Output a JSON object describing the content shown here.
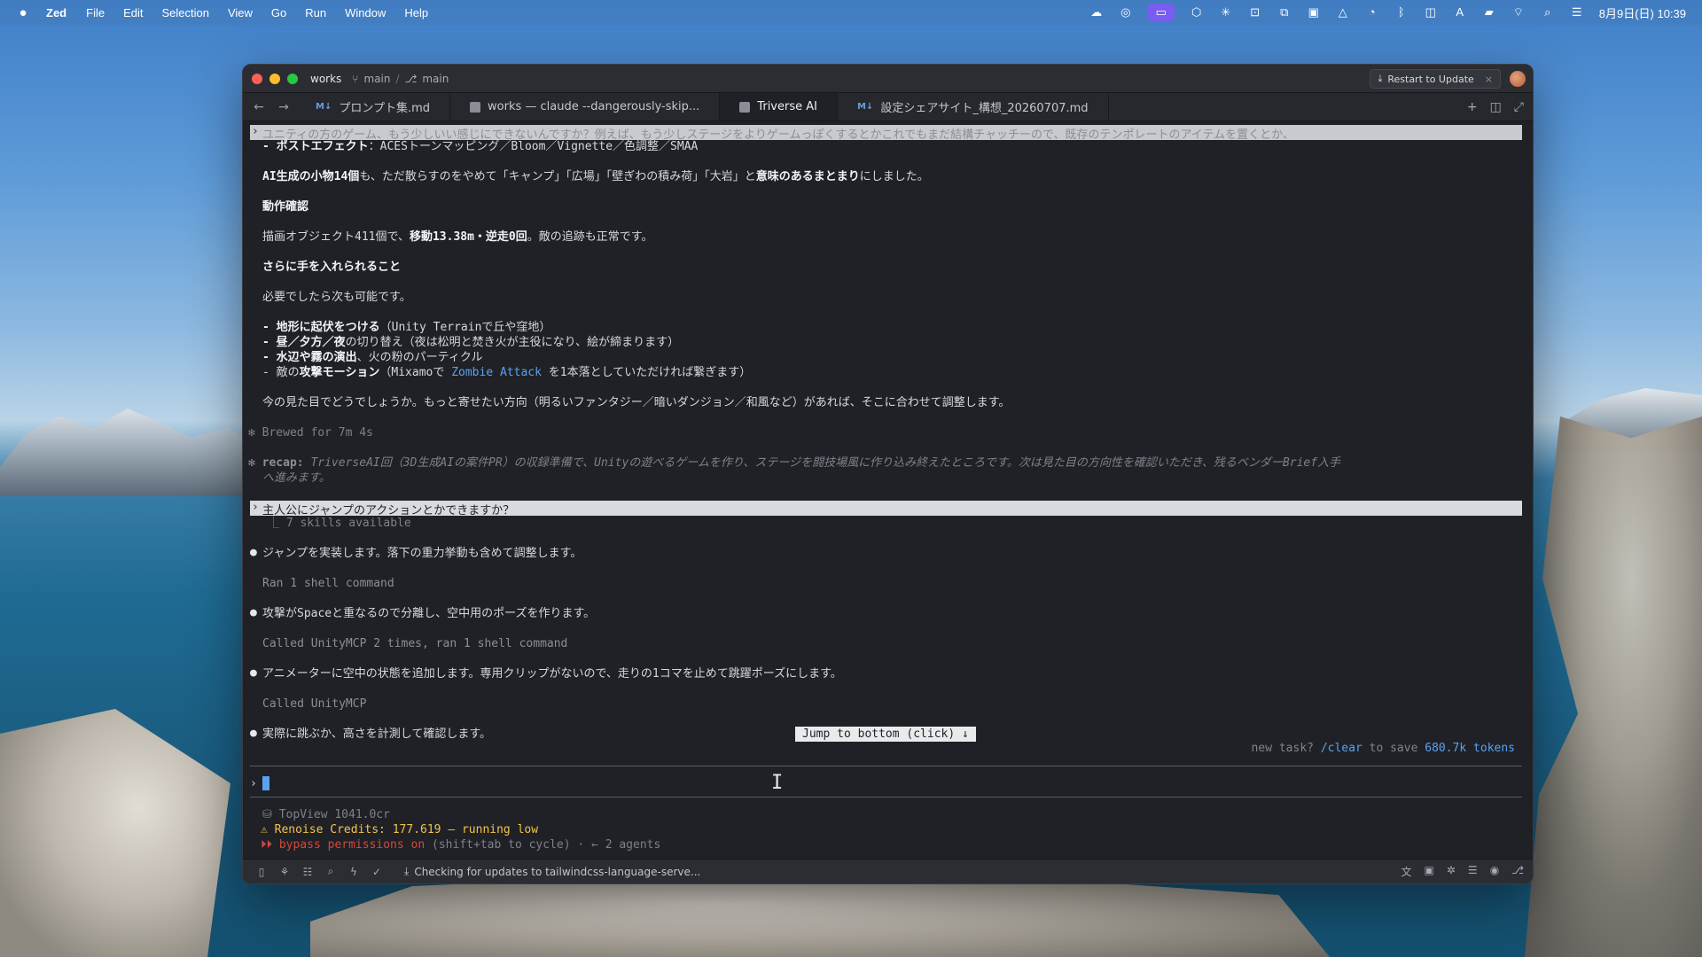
{
  "menubar": {
    "app_name": "Zed",
    "items": [
      "File",
      "Edit",
      "Selection",
      "View",
      "Go",
      "Run",
      "Window",
      "Help"
    ],
    "clock": "8月9日(日) 10:39",
    "input_indicator": "A"
  },
  "window": {
    "project": "works",
    "branch_1": "main",
    "branch_2": "main",
    "restart_label": "Restart to Update",
    "tabs": [
      {
        "label": "プロンプト集.md",
        "icon": "md-icon",
        "active": false
      },
      {
        "label": "works — claude --dangerously-skip...",
        "icon": "terminal-icon",
        "active": false
      },
      {
        "label": "Triverse AI",
        "icon": "terminal-icon",
        "active": true
      },
      {
        "label": "設定シェアサイト_構想_20260707.md",
        "icon": "md-icon",
        "active": false
      }
    ]
  },
  "terminal": {
    "top_prompt": "ユニティの方のゲーム、もう少しいい感じにできないんですか？例えば、もう少しステージをよりゲームっぽくするとかこれでもまだ結構チャッチーので、既存のテンポレートのアイテムを置くとか、",
    "post_effect_label": "- ポストエフェクト",
    "post_effect_value": "：ACESトーンマッピング／Bloom／Vignette／色調整／SMAA",
    "ai_items_bold": "AI生成の小物14個",
    "ai_items_mid": "も、ただ散らすのをやめて「キャンプ」「広場」「壁ぎわの積み荷」「大岩」と",
    "ai_items_bold2": "意味のあるまとまり",
    "ai_items_end": "にしました。",
    "check_heading": "動作確認",
    "check_pre": "描画オブジェクト411個で、",
    "check_bold": "移動13.38m・逆走0回",
    "check_end": "。敵の追跡も正常です。",
    "more_heading": "さらに手を入れられること",
    "more_intro": "必要でしたら次も可能です。",
    "opt1_bold": "- 地形に起伏をつける",
    "opt1_rest": "（Unity Terrainで丘や窪地）",
    "opt2_bold": "- 昼／夕方／夜",
    "opt2_rest": "の切り替え（夜は松明と焚き火が主役になり、絵が締まります）",
    "opt3_bold": "- 水辺や霧の演出",
    "opt3_rest": "、火の粉のパーティクル",
    "opt4_pre": "- 敵の",
    "opt4_bold": "攻撃モーション",
    "opt4_mid": "（Mixamoで ",
    "opt4_link": "Zombie Attack",
    "opt4_end": " を1本落としていただければ繋ぎます）",
    "question": "今の見た目でどうでしょうか。もっと寄せたい方向（明るいファンタジー／暗いダンジョン／和風など）があれば、そこに合わせて調整します。",
    "brewed": "✻ Brewed for 7m 4s",
    "recap_label": "✻ recap:",
    "recap_text": " TriverseAI回（3D生成AIの案件PR）の収録準備で、Unityの遊べるゲームを作り、ステージを闘技場風に作り込み終えたところです。次は見た目の方向性を確認いただき、残るベンダーBrief入手",
    "recap_text2": "へ進みます。",
    "user_prompt": "主人公にジャンプのアクションとかできますか？",
    "skills": "⎿ 7 skills available",
    "step1": "ジャンプを実装します。落下の重力挙動も含めて調整します。",
    "step1_tool": "Ran 1 shell command",
    "step2": "攻撃がSpaceと重なるので分離し、空中用のポーズを作ります。",
    "step2_tool": "Called UnityMCP 2 times, ran 1 shell command",
    "step3": "アニメーターに空中の状態を追加します。専用クリップがないので、走りの1コマを止めて跳躍ポーズにします。",
    "step3_tool": "Called UnityMCP",
    "step4": "実際に跳ぶか、高さを計測して確認します。",
    "jump_button": "Jump to bottom (click) ↓",
    "hint_pre": "new task? ",
    "hint_cmd": "/clear",
    "hint_mid": " to save ",
    "hint_tokens": "680.7k tokens",
    "footer_topview": "TopView 1041.0cr",
    "footer_credits": "Renoise Credits: 177.619 — running low",
    "footer_mode": "bypass permissions on",
    "footer_mode_rest": " (shift+tab to cycle) · ← 2 agents"
  },
  "statusbar": {
    "message": "Checking for updates to tailwindcss-language-serve..."
  }
}
